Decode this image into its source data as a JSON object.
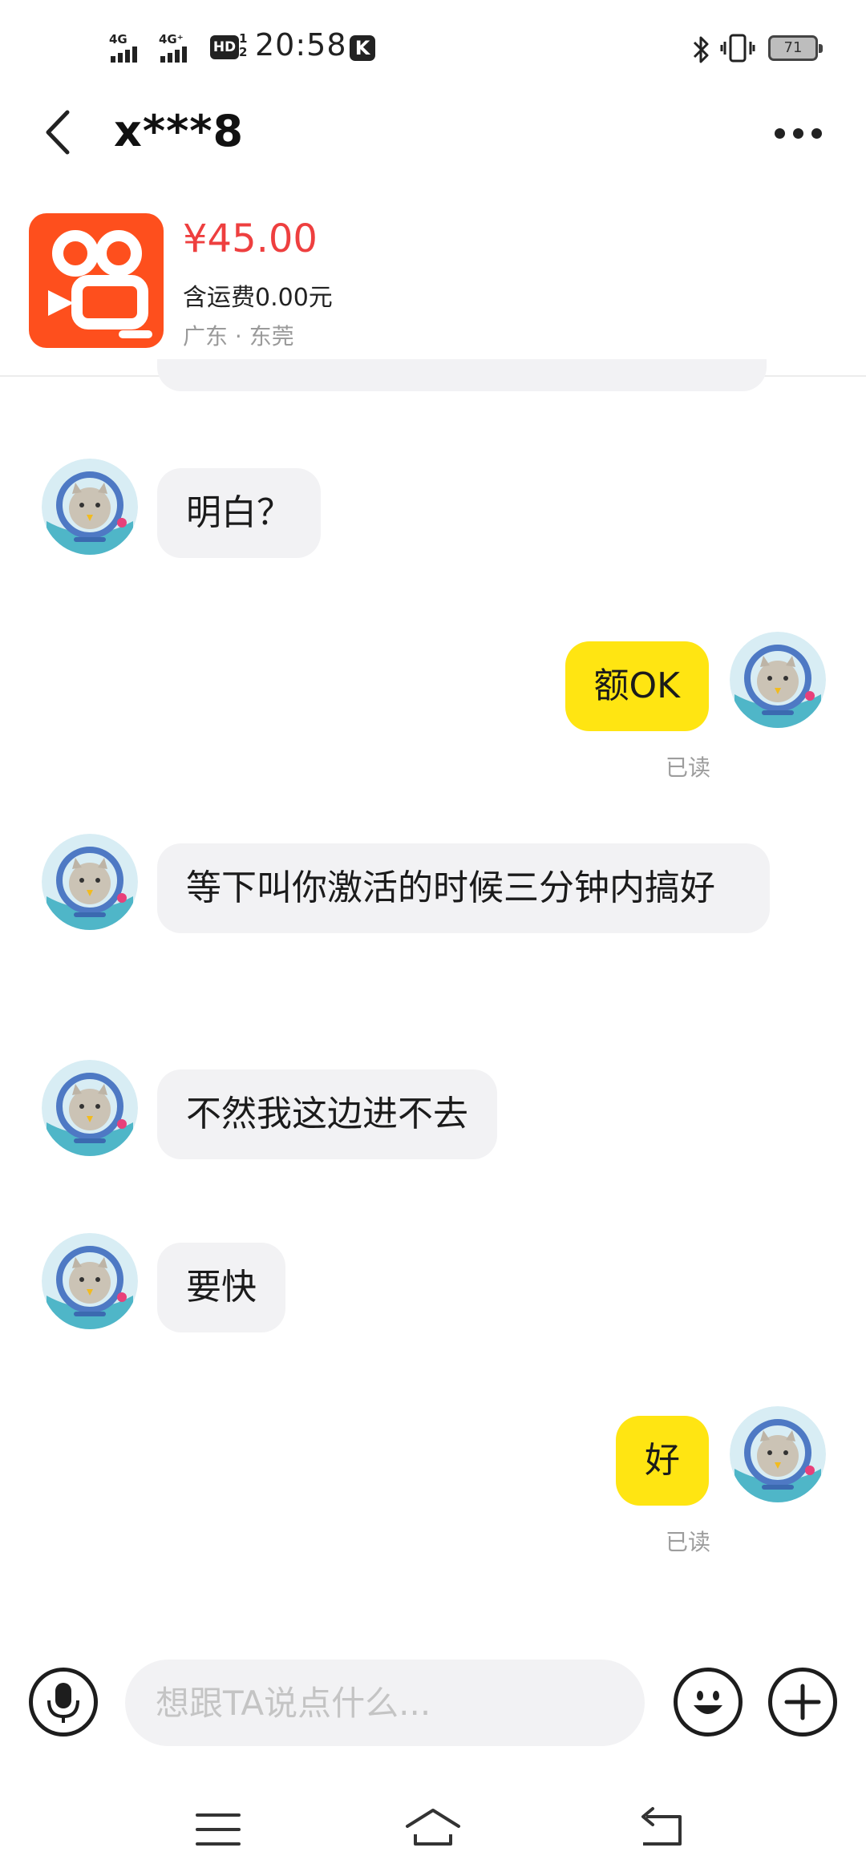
{
  "status_bar": {
    "net1": "4G",
    "net2": "4G⁺",
    "hd": "HD",
    "hd_sub": "1\n2",
    "time": "20:58",
    "k_badge": "K",
    "battery": "71"
  },
  "header": {
    "title": "x***8"
  },
  "product": {
    "price": "¥45.00",
    "shipping": "含运费0.00元",
    "location": "广东 · 东莞"
  },
  "messages": [
    {
      "side": "in",
      "text": "明白？"
    },
    {
      "side": "out",
      "text": "额OK",
      "status": "已读"
    },
    {
      "side": "in",
      "text": "等下叫你激活的时候三分钟内搞好"
    },
    {
      "side": "in",
      "text": "不然我这边进不去"
    },
    {
      "side": "in",
      "text": "要快"
    },
    {
      "side": "out",
      "text": "好",
      "status": "已读"
    }
  ],
  "input": {
    "placeholder": "想跟TA说点什么..."
  },
  "colors": {
    "outgoing_bubble": "#ffe512",
    "incoming_bubble": "#f2f2f4",
    "price": "#ee3f3f",
    "app_icon": "#fe4f1d"
  }
}
